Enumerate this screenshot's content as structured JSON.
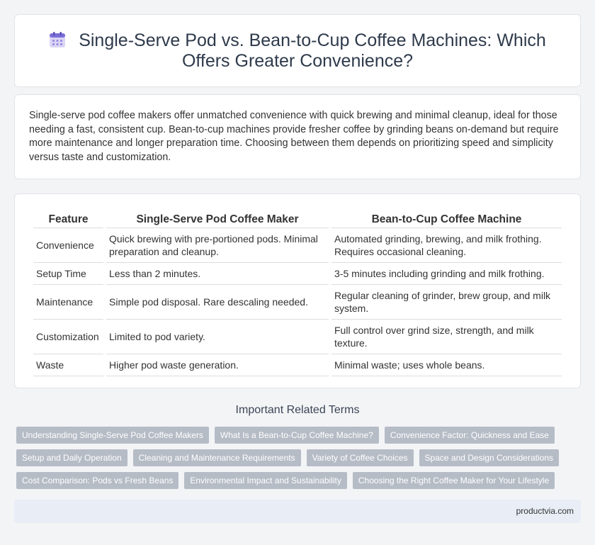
{
  "header": {
    "icon": "calendar-icon",
    "title": "Single-Serve Pod vs. Bean-to-Cup Coffee Machines: Which Offers Greater Convenience?"
  },
  "intro": "Single-serve pod coffee makers offer unmatched convenience with quick brewing and minimal cleanup, ideal for those needing a fast, consistent cup. Bean-to-cup machines provide fresher coffee by grinding beans on-demand but require more maintenance and longer preparation time. Choosing between them depends on prioritizing speed and simplicity versus taste and customization.",
  "table": {
    "headers": [
      "Feature",
      "Single-Serve Pod Coffee Maker",
      "Bean-to-Cup Coffee Machine"
    ],
    "rows": [
      [
        "Convenience",
        "Quick brewing with pre-portioned pods. Minimal preparation and cleanup.",
        "Automated grinding, brewing, and milk frothing. Requires occasional cleaning."
      ],
      [
        "Setup Time",
        "Less than 2 minutes.",
        "3-5 minutes including grinding and milk frothing."
      ],
      [
        "Maintenance",
        "Simple pod disposal. Rare descaling needed.",
        "Regular cleaning of grinder, brew group, and milk system."
      ],
      [
        "Customization",
        "Limited to pod variety.",
        "Full control over grind size, strength, and milk texture."
      ],
      [
        "Waste",
        "Higher pod waste generation.",
        "Minimal waste; uses whole beans."
      ]
    ]
  },
  "related": {
    "heading": "Important Related Terms",
    "tags": [
      "Understanding Single-Serve Pod Coffee Makers",
      "What Is a Bean-to-Cup Coffee Machine?",
      "Convenience Factor: Quickness and Ease",
      "Setup and Daily Operation",
      "Cleaning and Maintenance Requirements",
      "Variety of Coffee Choices",
      "Space and Design Considerations",
      "Cost Comparison: Pods vs Fresh Beans",
      "Environmental Impact and Sustainability",
      "Choosing the Right Coffee Maker for Your Lifestyle"
    ]
  },
  "footer": {
    "site": "productvia.com"
  },
  "colors": {
    "tag_bg": "#b6bcc6",
    "footer_bg": "#e8edf6",
    "title": "#2e3a4b"
  }
}
